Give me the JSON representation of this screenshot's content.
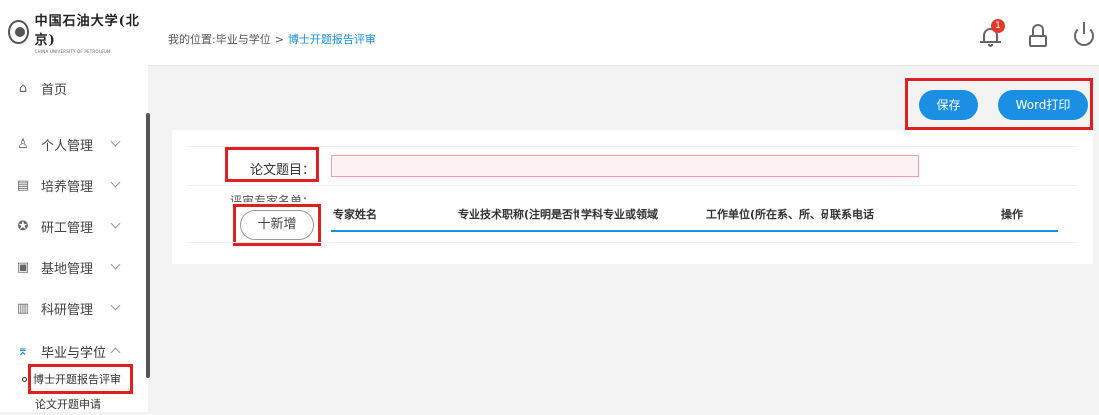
{
  "sidebar": {
    "logo_cn": "中国石油大学(北京)",
    "logo_en": "CHINA UNIVERSITY OF PETROLEUM",
    "items": [
      {
        "label": "首页",
        "icon": "home-icon"
      },
      {
        "label": "个人管理",
        "icon": "user-icon"
      },
      {
        "label": "培养管理",
        "icon": "chart-icon"
      },
      {
        "label": "研工管理",
        "icon": "award-icon"
      },
      {
        "label": "基地管理",
        "icon": "briefcase-icon"
      },
      {
        "label": "科研管理",
        "icon": "bar-chart-icon"
      },
      {
        "label": "毕业与学位",
        "icon": "graduation-cap-icon"
      }
    ],
    "sub_items": [
      {
        "label": "博士开题报告评审"
      },
      {
        "label": "论文开题申请"
      }
    ]
  },
  "header": {
    "breadcrumb_prefix": "我的位置:",
    "breadcrumb_parent": "毕业与学位",
    "breadcrumb_separator": ">",
    "breadcrumb_current": "博士开题报告评审",
    "notification_count": "1"
  },
  "toolbar": {
    "save_label": "保存",
    "word_print_label": "Word打印"
  },
  "form": {
    "title_label": "论文题目：",
    "title_value": "",
    "experts_label": "评审专家名单：",
    "add_label": "十新增",
    "columns": [
      "专家姓名",
      "专业技术职称(注明是否博",
      "学科专业或领域",
      "工作单位(所在系、所、研",
      "联系电话",
      "操作"
    ]
  },
  "colors": {
    "accent": "#1a8fe3",
    "highlight": "#e02020",
    "badge": "#e23b2e"
  }
}
